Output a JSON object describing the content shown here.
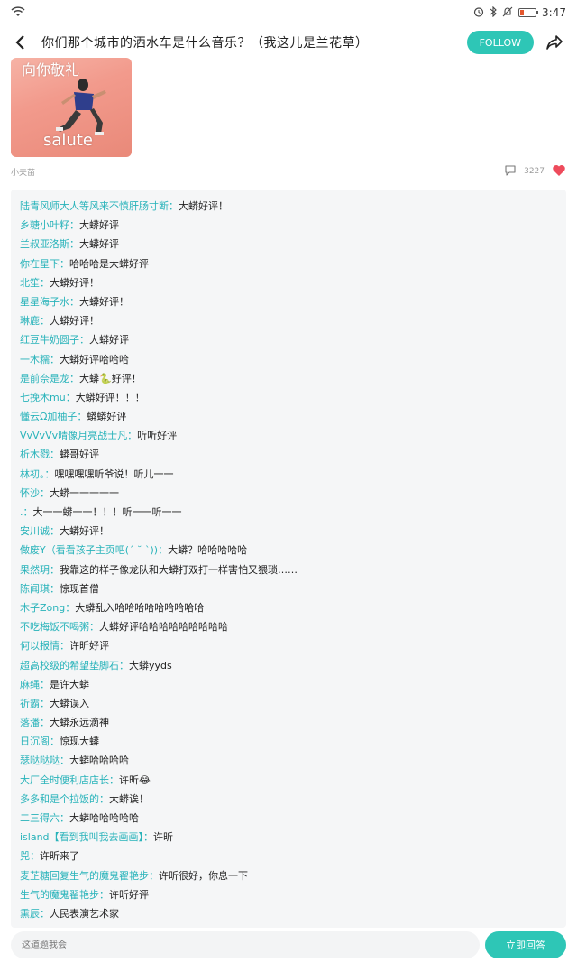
{
  "status_bar": {
    "time": "3:47",
    "battery_level": 0.25,
    "battery_color": "#e4572e"
  },
  "header": {
    "title": "你们那个城市的洒水车是什么音乐？（我这儿是兰花草）",
    "follow_label": "FOLLOW",
    "accent_color": "#2ec6b6"
  },
  "image": {
    "top_text": "向你敬礼",
    "bottom_text": "salute"
  },
  "meta": {
    "author": "小夫苗",
    "like_count": "3227"
  },
  "comments": [
    {
      "user": "陆青风师大人等风来不慎肝肠寸断",
      "text": "大蟒好评！"
    },
    {
      "user": "乡糖小叶籽",
      "text": "大蟒好评"
    },
    {
      "user": "兰叔亚洛斯",
      "text": "大蟒好评"
    },
    {
      "user": "你在星下",
      "text": "哈哈哈是大蟒好评"
    },
    {
      "user": "北笙",
      "text": "大蟒好评！"
    },
    {
      "user": "星星海子水",
      "text": "大蟒好评！"
    },
    {
      "user": "琳鹿",
      "text": "大蟒好评！"
    },
    {
      "user": "红豆牛奶圆子",
      "text": "大蟒好评"
    },
    {
      "user": "一木糯",
      "text": "大蟒好评哈哈哈"
    },
    {
      "user": "是前奈是龙",
      "text": "大蟒🐍好评！"
    },
    {
      "user": "七挽木mu",
      "text": "大蟒好评！！！"
    },
    {
      "user": "懂云Ω加柚子",
      "text": "蟒蟒好评"
    },
    {
      "user": "VvVvVv晴像月亮战士凡",
      "text": "听听好评"
    },
    {
      "user": "析木戮",
      "text": "蟒哥好评"
    },
    {
      "user": "林初。",
      "text": "嘿嘿嘿嘿听爷说！听儿一一"
    },
    {
      "user": "怀沙",
      "text": "大蟒一一一一一"
    },
    {
      "user": ".",
      "text": "大一一蟒一一！！！听一一听一一"
    },
    {
      "user": "安川诚",
      "text": "大蟒好评！"
    },
    {
      "user": "做废Y（看看孩子主页吧(´ ˘ `))",
      "text": "大蟒？哈哈哈哈哈"
    },
    {
      "user": "果然玥",
      "text": "我靠这的样子像龙队和大蟒打双打一样害怕又猥琐……"
    },
    {
      "user": "陈闻琪",
      "text": "惊现首僧"
    },
    {
      "user": "木子Zong",
      "text": "大蟒乱入哈哈哈哈哈哈哈哈哈"
    },
    {
      "user": "不吃梅饭不喝粥",
      "text": "大蟒好评哈哈哈哈哈哈哈哈哈"
    },
    {
      "user": "何以报情",
      "text": "许昕好评"
    },
    {
      "user": "超高校级的希望垫脚石",
      "text": "大蟒yyds"
    },
    {
      "user": "麻绳",
      "text": "是许大蟒"
    },
    {
      "user": "祈霸",
      "text": "大蟒误入"
    },
    {
      "user": "落潘",
      "text": "大蟒永远滴神"
    },
    {
      "user": "日沉阁",
      "text": "惊现大蟒"
    },
    {
      "user": "瑟哒哒哒",
      "text": "大蟒哈哈哈哈"
    },
    {
      "user": "大厂全时便利店店长",
      "text": "许昕😂"
    },
    {
      "user": "多多和是个拉饭的",
      "text": "大蟒诶！"
    },
    {
      "user": "二三得六",
      "text": "大蟒哈哈哈哈哈"
    },
    {
      "user": "island【看到我叫我去画画】",
      "text": "许昕"
    },
    {
      "user": "兕",
      "text": "许昕来了"
    },
    {
      "user": "麦芷糖回复生气的魔鬼翟艳步",
      "text": "许昕很好，你息一下"
    },
    {
      "user": "生气的魔鬼翟艳步",
      "text": "许昕好评"
    },
    {
      "user": "熏辰",
      "text": "人民表演艺术家"
    }
  ],
  "bottom": {
    "input_placeholder": "这道题我会",
    "reply_label": "立即回答"
  }
}
